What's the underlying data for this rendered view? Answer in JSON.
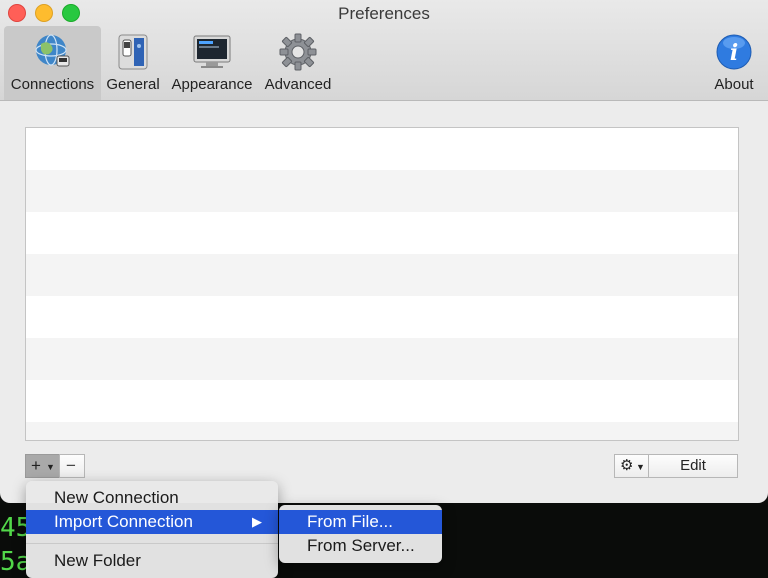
{
  "window": {
    "title": "Preferences"
  },
  "toolbar": {
    "items": [
      {
        "label": "Connections",
        "icon": "globe-network-icon"
      },
      {
        "label": "General",
        "icon": "switch-panel-icon"
      },
      {
        "label": "Appearance",
        "icon": "monitor-icon"
      },
      {
        "label": "Advanced",
        "icon": "gear-icon"
      }
    ],
    "about_label": "About",
    "selected": "Connections"
  },
  "list": {
    "rows": 8
  },
  "buttons": {
    "add_label": "+",
    "remove_label": "−",
    "edit_label": "Edit"
  },
  "menu": {
    "items": [
      "New Connection",
      "Import Connection",
      "New Folder"
    ],
    "highlighted": "Import Connection",
    "submenu": {
      "items": [
        "From File...",
        "From Server..."
      ],
      "highlighted": "From File..."
    }
  },
  "terminal": {
    "lines": [
      "45",
      "5a"
    ]
  },
  "colors": {
    "highlight": "#2457d8",
    "terminal_text": "#52d84a"
  }
}
